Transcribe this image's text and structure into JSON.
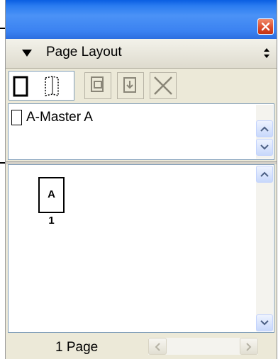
{
  "window": {
    "close_icon": "close-x-icon"
  },
  "panel": {
    "title": "Page Layout",
    "collapse_icon": "triangle-down-icon",
    "menu_icon": "updown-arrows-icon"
  },
  "toolbar": {
    "buttons": [
      {
        "name": "new-single-page-button",
        "icon": "single-page-icon"
      },
      {
        "name": "new-facing-page-button",
        "icon": "facing-page-icon"
      },
      {
        "name": "duplicate-page-button",
        "icon": "duplicate-icon"
      },
      {
        "name": "import-page-button",
        "icon": "import-icon"
      },
      {
        "name": "delete-page-button",
        "icon": "x-icon"
      }
    ]
  },
  "masters": {
    "items": [
      {
        "label": "A-Master A"
      }
    ]
  },
  "pages": {
    "items": [
      {
        "master_letter": "A",
        "number": "1"
      }
    ]
  },
  "status": {
    "page_count": "1 Page"
  },
  "colors": {
    "titlebar": "#3b82f1",
    "close": "#d9492a",
    "panel_bg": "#ece9d8",
    "scroll_border": "#7f9db9"
  }
}
